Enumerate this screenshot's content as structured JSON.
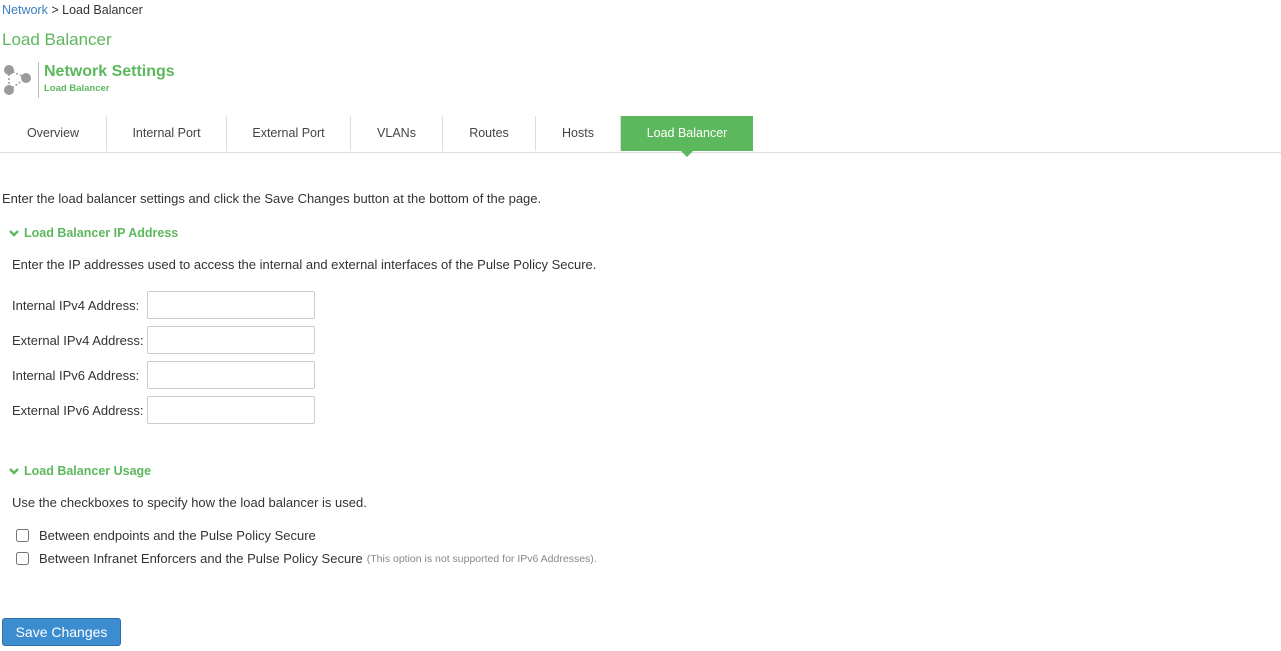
{
  "breadcrumb": {
    "parent": "Network",
    "separator": ">",
    "current": "Load Balancer"
  },
  "page_title": "Load Balancer",
  "header": {
    "title": "Network Settings",
    "subtitle": "Load Balancer",
    "icon": "network-icon"
  },
  "tabs": [
    {
      "label": "Overview",
      "active": false
    },
    {
      "label": "Internal Port",
      "active": false
    },
    {
      "label": "External Port",
      "active": false
    },
    {
      "label": "VLANs",
      "active": false
    },
    {
      "label": "Routes",
      "active": false
    },
    {
      "label": "Hosts",
      "active": false
    },
    {
      "label": "Load Balancer",
      "active": true
    }
  ],
  "intro": "Enter the load balancer settings and click the Save Changes button at the bottom of the page.",
  "ip_section": {
    "title": "Load Balancer IP Address",
    "description": "Enter the IP addresses used to access the internal and external interfaces of the Pulse Policy Secure.",
    "fields": [
      {
        "label": "Internal IPv4 Address:",
        "value": ""
      },
      {
        "label": "External IPv4 Address:",
        "value": ""
      },
      {
        "label": "Internal IPv6 Address:",
        "value": ""
      },
      {
        "label": "External IPv6 Address:",
        "value": ""
      }
    ]
  },
  "usage_section": {
    "title": "Load Balancer Usage",
    "description": "Use the checkboxes to specify how the load balancer is used.",
    "options": [
      {
        "label": "Between endpoints and the Pulse Policy Secure",
        "checked": false,
        "note": ""
      },
      {
        "label": "Between Infranet Enforcers and the Pulse Policy Secure",
        "checked": false,
        "note": "(This option is not supported for IPv6 Addresses)."
      }
    ]
  },
  "save_button": "Save Changes",
  "colors": {
    "accent_green": "#5cb85c",
    "link_blue": "#3a7fc4",
    "button_blue": "#3c8dd0"
  }
}
